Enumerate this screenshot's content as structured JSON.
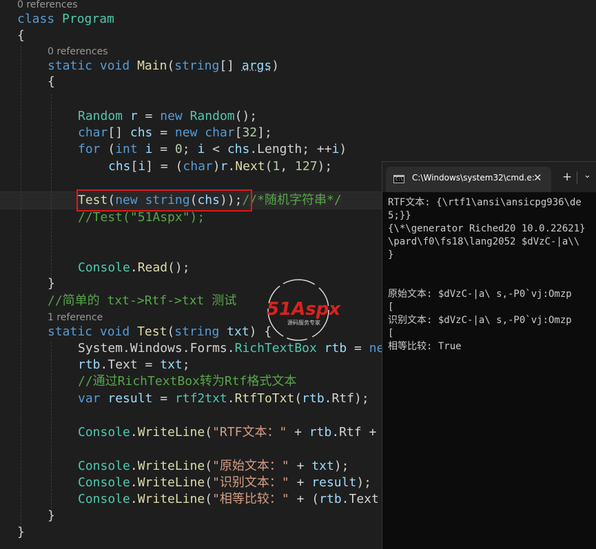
{
  "editor": {
    "lens_class": "0 references",
    "lens_main": "0 references",
    "lens_test": "1 reference",
    "t_class": "class",
    "t_program": "Program",
    "t_brace_open": "{",
    "t_brace_close": "}",
    "t_static": "static",
    "t_void": "void",
    "t_main": "Main",
    "t_string": "string",
    "t_args": "args",
    "t_random": "Random",
    "t_r": "r",
    "t_new": "new",
    "t_char": "char",
    "t_chs": "chs",
    "t_32": "32",
    "t_for": "for",
    "t_int": "int",
    "t_i": "i",
    "t_0": "0",
    "t_length": "Length",
    "t_next": "Next",
    "t_1": "1",
    "t_127": "127",
    "t_test": "Test",
    "t_comment_random": "//*随机字符串*/",
    "t_comment_test": "//Test(\"51Aspx\");",
    "t_console": "Console",
    "t_read": "Read",
    "t_comment_simple": "//简单的 txt->Rtf->txt 测试",
    "t_txt": "txt",
    "t_system": "System",
    "t_windows": "Windows",
    "t_forms": "Forms",
    "t_richtextbox": "RichTextBox",
    "t_rtb": "rtb",
    "t_ne": "ne",
    "t_text": "Text",
    "t_comment_rtf": "//通过RichTextBox转为Rtf格式文本",
    "t_var": "var",
    "t_result": "result",
    "t_rtf2txt": "rtf2txt",
    "t_rtftotxt": "RtfToTxt",
    "t_rtf": "Rtf",
    "t_writeline": "WriteLine",
    "t_str_rtf": "\"RTF文本：\"",
    "t_str_orig": "\"原始文本：\"",
    "t_str_recog": "\"识别文本：\"",
    "t_str_equal": "\"相等比较：\""
  },
  "watermark": {
    "logo_text": "51Aspx",
    "tagline": "源码服务专家"
  },
  "terminal": {
    "tab_title": "C:\\Windows\\system32\\cmd.e:",
    "close_glyph": "✕",
    "newtab_glyph": "+",
    "dropdown_glyph": "⌄",
    "icon_text": "C:\\",
    "lines": [
      "RTF文本: {\\rtf1\\ansi\\ansicpg936\\de",
      "5;}}",
      "{\\*\\generator Riched20 10.0.22621}",
      "\\pard\\f0\\fs18\\lang2052 $dVzC-|a\\\\",
      "}",
      "",
      "",
      "原始文本: $dVzC-|a\\ s,-P0`vj:Omzp",
      "[",
      "识别文本: $dVzC-|a\\ s,-P0`vj:Omzp",
      "[",
      "相等比较: True"
    ]
  },
  "colors": {
    "background": "#1e1e1e",
    "keyword": "#569cd6",
    "type": "#4ec9b0",
    "method": "#dcdcaa",
    "variable": "#9cdcfe",
    "number": "#b5cea8",
    "string": "#d69d85",
    "comment": "#57a64a",
    "highlight_box": "#e0191a",
    "terminal_bg": "#0c0c0c"
  }
}
